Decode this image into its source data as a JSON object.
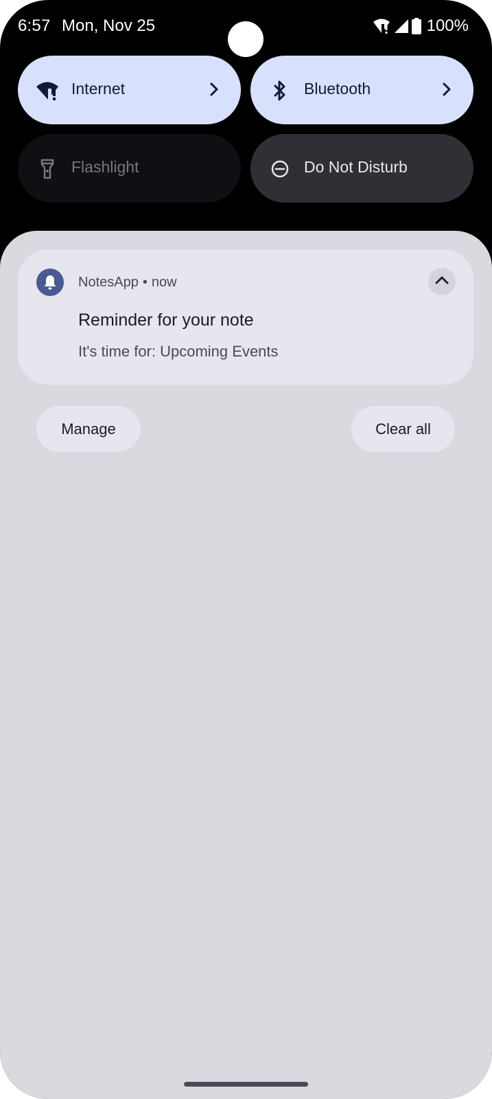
{
  "status_bar": {
    "time": "6:57",
    "date": "Mon, Nov 25",
    "battery": "100%",
    "icons": [
      "wifi-alert-icon",
      "cell-signal-icon",
      "battery-icon"
    ]
  },
  "quick_settings": [
    {
      "label": "Internet",
      "icon": "wifi-alert-icon",
      "state": "active",
      "has_chevron": true
    },
    {
      "label": "Bluetooth",
      "icon": "bluetooth-icon",
      "state": "active",
      "has_chevron": true
    },
    {
      "label": "Flashlight",
      "icon": "flashlight-icon",
      "state": "unavailable",
      "has_chevron": false
    },
    {
      "label": "Do Not Disturb",
      "icon": "dnd-icon",
      "state": "off",
      "has_chevron": false
    }
  ],
  "notification": {
    "app_name": "NotesApp",
    "separator": "•",
    "time": "now",
    "title": "Reminder for your note",
    "body": "It's time for: Upcoming Events",
    "icon": "bell-icon",
    "expanded": true
  },
  "actions": {
    "manage_label": "Manage",
    "clear_all_label": "Clear all"
  },
  "colors": {
    "active_tile": "#d8e1fb",
    "shade_background": "#dad9e0",
    "card_background": "#e7e6ef",
    "app_icon": "#4a5a93"
  }
}
